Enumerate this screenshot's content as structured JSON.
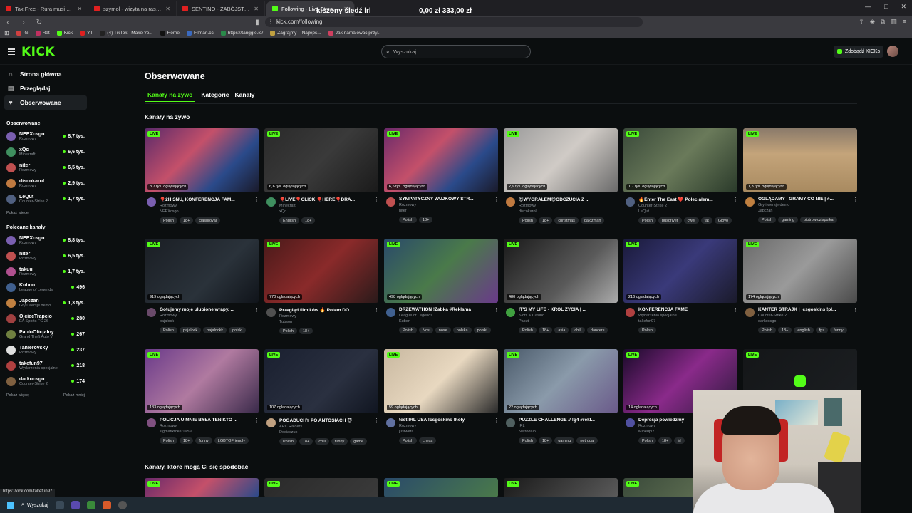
{
  "browser": {
    "tabs": [
      {
        "label": "Tax Free - Rura musi yeah (prod. CLL",
        "active": false,
        "icon": "youtube-icon"
      },
      {
        "label": "szymol - wizyta na rasze! - YouTube",
        "active": false,
        "icon": "youtube-icon"
      },
      {
        "label": "SENTINO - ZABÓJSTWO LIRYCZNE 5",
        "active": false,
        "icon": "youtube-icon"
      },
      {
        "label": "Following - Live Streams on Kick",
        "active": true,
        "icon": "kick-icon"
      }
    ],
    "url": "kick.com/following",
    "bookmarks": [
      "IG",
      "Rat",
      "Kick",
      "YT",
      "(4) TikTok - Make Yo...",
      "Home",
      "Filman.cc",
      "https://tanggle.io/",
      "Zagrajmy – Najleps...",
      "Jak namalować przy..."
    ],
    "overlay_title": "kiszony śledź lrl",
    "overlay_balance": "0,00 zł  333,00 zł",
    "status_url": "https://kick.com/takefun97"
  },
  "header": {
    "logo": "KICK",
    "search_placeholder": "Wyszukaj",
    "kicks_button": "Zdobądź KICKs"
  },
  "sidebar": {
    "nav": [
      {
        "label": "Strona główna",
        "icon": "home-icon"
      },
      {
        "label": "Przeglądaj",
        "icon": "browse-icon"
      },
      {
        "label": "Obserwowane",
        "icon": "heart-icon"
      }
    ],
    "followed_title": "Obserwowane",
    "followed": [
      {
        "name": "NEEXcsgo",
        "category": "Rozmowy",
        "viewers": "8,7 tys.",
        "color": "#7a5fb0"
      },
      {
        "name": "xQc",
        "category": "Minecraft",
        "viewers": "6,6 tys.",
        "color": "#3f8f5f"
      },
      {
        "name": "niter",
        "category": "Rozmowy",
        "viewers": "6,5 tys.",
        "color": "#c05050"
      },
      {
        "name": "discokarol",
        "category": "Rozmowy",
        "viewers": "2,9 tys.",
        "color": "#c07a40"
      },
      {
        "name": "LeQut",
        "category": "Counter-Strike 2",
        "viewers": "1,7 tys.",
        "color": "#506080"
      }
    ],
    "show_more": "Pokaż więcej",
    "recommended_title": "Polecane kanały",
    "recommended": [
      {
        "name": "NEEXcsgo",
        "category": "Rozmowy",
        "viewers": "8,8 tys.",
        "color": "#7a5fb0"
      },
      {
        "name": "niter",
        "category": "Rozmowy",
        "viewers": "6,5 tys.",
        "color": "#c05050"
      },
      {
        "name": "takuu",
        "category": "Rozmowy",
        "viewers": "1,7 tys.",
        "color": "#b0508f"
      },
      {
        "name": "Kubon",
        "category": "League of Legends",
        "viewers": "496",
        "color": "#40608f"
      },
      {
        "name": "Japczan",
        "category": "Gry i wersje demo",
        "viewers": "1,3 tys.",
        "color": "#c08040"
      },
      {
        "name": "OjciecTrapcio",
        "category": "EA Sports FC 26",
        "viewers": "280",
        "color": "#a04040"
      },
      {
        "name": "PabloOficjalny",
        "category": "Grand Theft Auto V",
        "viewers": "267",
        "color": "#708040"
      },
      {
        "name": "Tahlerovsky",
        "category": "Rozmowy",
        "viewers": "237",
        "color": "#e0e0e0"
      },
      {
        "name": "takefun97",
        "category": "Wydarzenia specjalne",
        "viewers": "218",
        "color": "#b04040"
      },
      {
        "name": "darkocsgo",
        "category": "Counter-Strike 2",
        "viewers": "174",
        "color": "#806040"
      }
    ],
    "show_more2": "Pokaż więcej",
    "show_less": "Pokaż mniej"
  },
  "main": {
    "title": "Obserwowane",
    "tabs": [
      "Kanały na żywo",
      "Kategorie",
      "Kanały"
    ],
    "section_live": "Kanały na żywo",
    "section_recommended": "Kanały, które mogą Ci się spodobać",
    "live_label": "LIVE",
    "cards": [
      {
        "viewers": "8,7 tys. oglądających",
        "title": "🎈2H SNU, KONFERENCJA FAM...",
        "category": "Rozmowy",
        "user": "NEEXcsgo",
        "tags": [
          "Polish",
          "18+",
          "clashroyal"
        ],
        "thumb": "linear-gradient(135deg,#5a2a6a,#c4506a 40%,#2a4a8a 70%,#1a1a2a)",
        "av": "#7a5fb0"
      },
      {
        "viewers": "6,6 tys. oglądających",
        "title": "🎈LIVE🎈CLICK 🎈HERE🎈DRA...",
        "category": "Minecraft",
        "user": "xQc",
        "tags": [
          "English",
          "18+"
        ],
        "thumb": "linear-gradient(135deg,#2a2a2a,#3a3a3a 50%,#1a1a1a)",
        "av": "#3f8f5f"
      },
      {
        "viewers": "6,5 tys. oglądających",
        "title": "SYMPATYCZNY WUJKOWY STR...",
        "category": "Rozmowy",
        "user": "niter",
        "tags": [
          "Polish",
          "18+"
        ],
        "thumb": "linear-gradient(135deg,#6a2a6a,#c4506a 40%,#2a4a8a 70%,#1a1a2a)",
        "av": "#c05050"
      },
      {
        "viewers": "2,9 tys. oglądających",
        "title": "😍WYGRAŁEM😍ODCZUCIA Z ...",
        "category": "Rozmowy",
        "user": "discokarol",
        "tags": [
          "Polish",
          "18+",
          "christmas",
          "dajczman"
        ],
        "thumb": "linear-gradient(135deg,#9a9a9a,#d0cbc6 50%,#6a6a6a)",
        "av": "#c07a40"
      },
      {
        "viewers": "1,7 tys. oglądających",
        "title": "🔥Enter The East ❤️ Poleciałem...",
        "category": "Counter-Strike 2",
        "user": "LeQut",
        "tags": [
          "Polish",
          "busdriver",
          "cwel",
          "fat",
          "Glovo"
        ],
        "thumb": "linear-gradient(135deg,#3a4a3a,#6a7a5a 50%,#2a3a2a)",
        "av": "#506080"
      },
      {
        "viewers": "1,3 tys. oglądających",
        "title": "OGLĄDAMY I GRAMY CO NIE | #...",
        "category": "Gry i wersje demo",
        "user": "Japczan",
        "tags": [
          "Polish",
          "gaming",
          "piotrowiczispulka"
        ],
        "thumb": "linear-gradient(180deg,#8a7a6a,#c4a47a 40%,#a88a60)",
        "av": "#c08040"
      },
      {
        "viewers": "919 oglądających",
        "title": "Gotujemy moje ulubione wrapy, ...",
        "category": "Rozmowy",
        "user": "pajalock",
        "tags": [
          "Polish",
          "pajalock",
          "pajalockk",
          "polski"
        ],
        "thumb": "linear-gradient(135deg,#1a1e24,#2a323a 60%,#10141a)",
        "av": "#6a4a6a"
      },
      {
        "viewers": "770 oglądających",
        "title": "Przegląd filmików 🔥 Potem DO...",
        "category": "Rozmowy",
        "user": "Tubson",
        "tags": [
          "Polish",
          "18+"
        ],
        "thumb": "linear-gradient(135deg,#4a1a1a,#8a2a2a 50%,#2a1a1a)",
        "av": "#505050"
      },
      {
        "viewers": "498 oglądających",
        "title": "DRZEWATHON !Żabka #Reklama",
        "category": "League of Legends",
        "user": "Kubon",
        "tags": [
          "Polish",
          "Nos",
          "nose",
          "polska",
          "polski"
        ],
        "thumb": "linear-gradient(135deg,#2a4a6a,#4a7a4a 50%,#6a3a8a)",
        "av": "#40608f"
      },
      {
        "viewers": "480 oglądających",
        "title": "IT'S MY LIFE - KRÓL ŻYCIA | ...",
        "category": "Slots & Casino",
        "user": "Pasut",
        "tags": [
          "Polish",
          "18+",
          "asia",
          "chill",
          "dancers"
        ],
        "thumb": "linear-gradient(135deg,#1a1a1a,#5a5a5a 60%,#aaaaaa)",
        "av": "#40a040"
      },
      {
        "viewers": "216 oglądających",
        "title": "KONFERENCJA FAME",
        "category": "Wydarzenia specjalne",
        "user": "takefun97",
        "tags": [
          "Polish"
        ],
        "thumb": "linear-gradient(135deg,#1a1a3a,#3a3a7a 50%,#1a1a2a)",
        "av": "#b04040"
      },
      {
        "viewers": "174 oglądających",
        "title": "KANTER STRAJK | !csgoskins !pl...",
        "category": "Counter-Strike 2",
        "user": "darkocsgo",
        "tags": [
          "Polish",
          "18+",
          "english",
          "fps",
          "funny"
        ],
        "thumb": "linear-gradient(135deg,#6a6a6a,#9a9a9a 50%,#4a4a4a)",
        "av": "#806040"
      },
      {
        "viewers": "133 oglądających",
        "title": "POLICJA U MNIE BYŁA TEN KTO ...",
        "category": "Rozmowy",
        "user": "sigmatiktoker1959",
        "tags": [
          "Polish",
          "18+",
          "funny",
          "LGBTQFriendly"
        ],
        "thumb": "linear-gradient(135deg,#6a3a8a,#b07aa0 50%,#3a2a4a)",
        "av": "#805080"
      },
      {
        "viewers": "107 oglądających",
        "title": "POGADUCHY PO ANTOSIACH 😇",
        "category": "ARC Raiders",
        "user": "Dosiaczux",
        "tags": [
          "Polish",
          "18+",
          "chill",
          "funny",
          "game"
        ],
        "thumb": "linear-gradient(135deg,#1a2030,#2a3040 60%,#101520)",
        "av": "#c0a080"
      },
      {
        "viewers": "59 oglądających",
        "title": "test IRL USA !csgoskins !holy",
        "category": "Rozmowy",
        "user": "justwera",
        "tags": [
          "Polish",
          "chess"
        ],
        "thumb": "linear-gradient(135deg,#c8b8a0,#e8d8c0 50%,#2a2a2a)",
        "av": "#6070a0"
      },
      {
        "viewers": "22 oglądających",
        "title": "PUZZLE CHALLENGE // !g4 #rekl...",
        "category": "IRL",
        "user": "Netrodalo",
        "tags": [
          "Polish",
          "18+",
          "gaming",
          "netrodal"
        ],
        "thumb": "linear-gradient(135deg,#4a5a6a,#8a9aaa 50%,#6a5a8a)",
        "av": "#506060"
      },
      {
        "viewers": "14 oglądających",
        "title": "Depresja powiedzmy",
        "category": "Rozmowy",
        "user": "Minedpl2",
        "tags": [
          "Polish",
          "18+",
          "irl"
        ],
        "thumb": "linear-gradient(135deg,#1a0a2a,#8a2a8a 50%,#2a1a3a)",
        "av": "#5050a0"
      },
      {
        "viewers": "",
        "title": "",
        "category": "",
        "user": "",
        "tags": [],
        "thumb": "linear-gradient(135deg,#141618,#1c1f22)",
        "av": "#333"
      }
    ],
    "rec_cards": [
      {
        "thumb": "linear-gradient(135deg,#6a2a6a,#c4506a 50%,#2a4a8a)"
      },
      {
        "thumb": "linear-gradient(135deg,#2a2a2a,#3a3a3a)"
      },
      {
        "thumb": "linear-gradient(135deg,#2a4a6a,#4a7a4a)"
      },
      {
        "thumb": "linear-gradient(135deg,#1a1a1a,#5a5a5a)"
      },
      {
        "thumb": "linear-gradient(135deg,#3a4a3a,#6a7a5a)"
      }
    ]
  },
  "taskbar": {
    "search": "Wyszukaj"
  },
  "colors": {
    "accent": "#53fc18",
    "background": "#0b0e0f"
  }
}
